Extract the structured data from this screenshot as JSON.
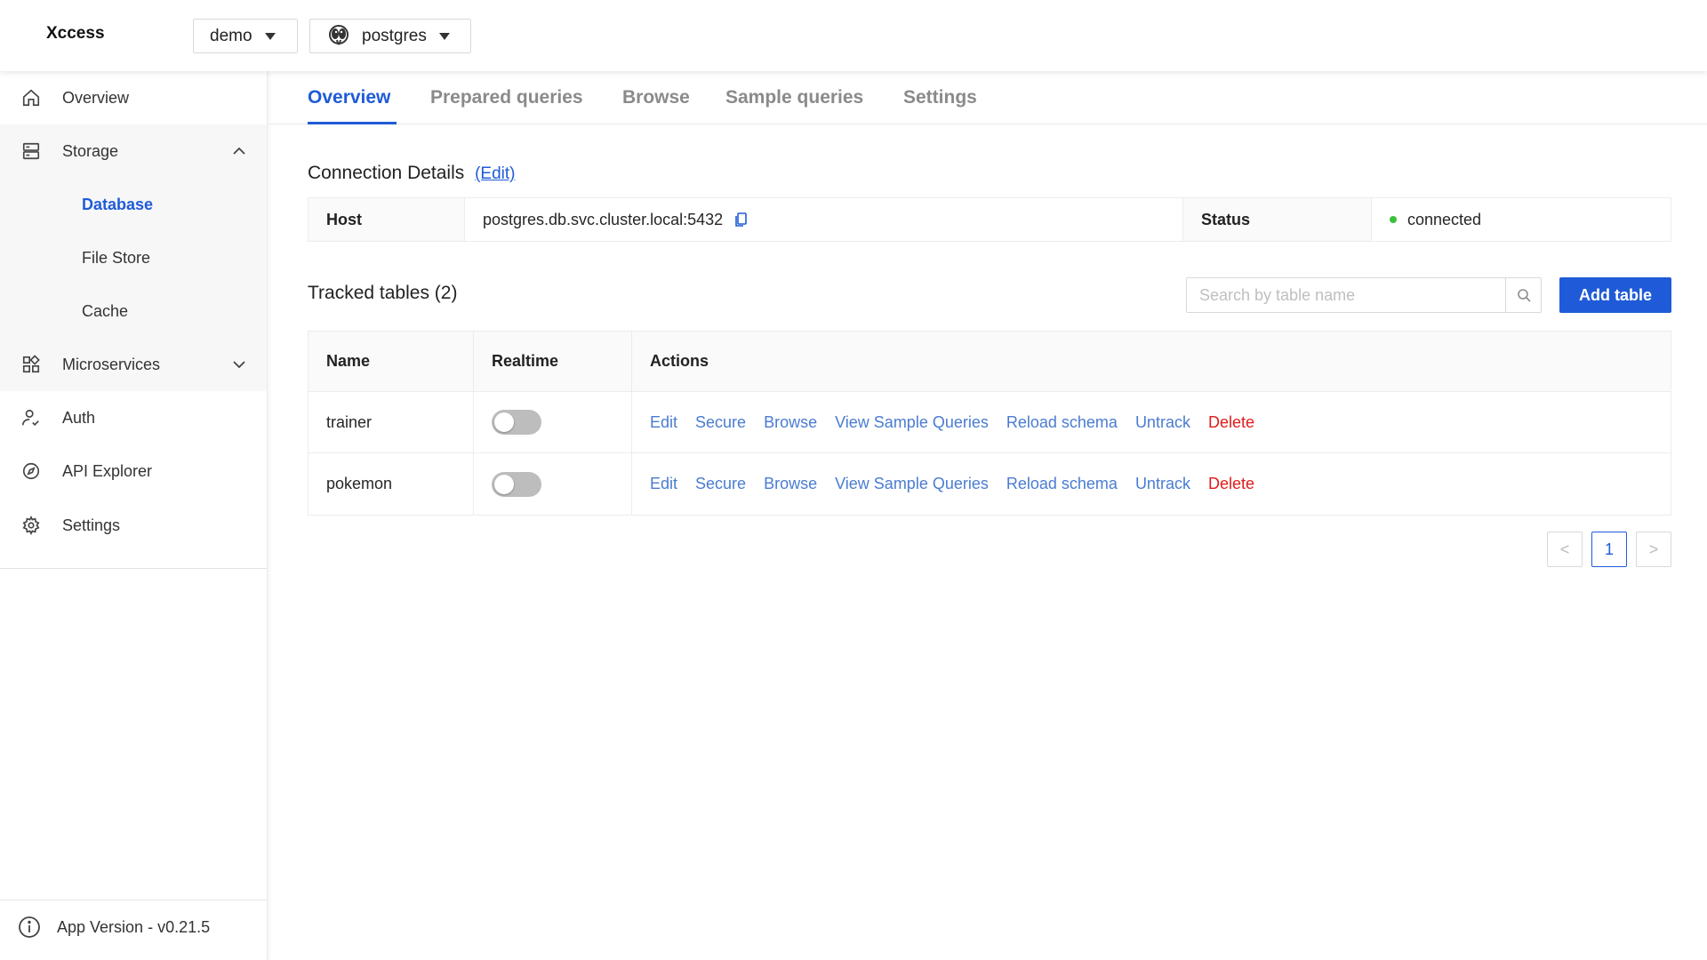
{
  "app": {
    "brand": "Xccess",
    "project_dropdown": "demo",
    "db_dropdown": "postgres"
  },
  "sidebar": {
    "overview": "Overview",
    "storage": "Storage",
    "storage_sub": [
      "Database",
      "File Store",
      "Cache"
    ],
    "microservices": "Microservices",
    "auth": "Auth",
    "api_explorer": "API Explorer",
    "settings": "Settings",
    "version": "App Version - v0.21.5"
  },
  "tabs": [
    "Overview",
    "Prepared queries",
    "Browse",
    "Sample queries",
    "Settings"
  ],
  "connection": {
    "title": "Connection Details",
    "edit": "(Edit)",
    "host_label": "Host",
    "host_value": "postgres.db.svc.cluster.local:5432",
    "status_label": "Status",
    "status_value": "connected"
  },
  "tracked": {
    "title": "Tracked tables (2)",
    "search_placeholder": "Search by table name",
    "add_button": "Add table",
    "columns": [
      "Name",
      "Realtime",
      "Actions"
    ],
    "rows": [
      {
        "name": "trainer",
        "realtime": false
      },
      {
        "name": "pokemon",
        "realtime": false
      }
    ],
    "actions": [
      "Edit",
      "Secure",
      "Browse",
      "View Sample Queries",
      "Reload schema",
      "Untrack",
      "Delete"
    ]
  },
  "pagination": {
    "current_page": "1",
    "prev": "<",
    "next": ">"
  },
  "colors": {
    "accent": "#1f5bd8",
    "danger": "#e01b1b",
    "success": "#3ac13a"
  }
}
